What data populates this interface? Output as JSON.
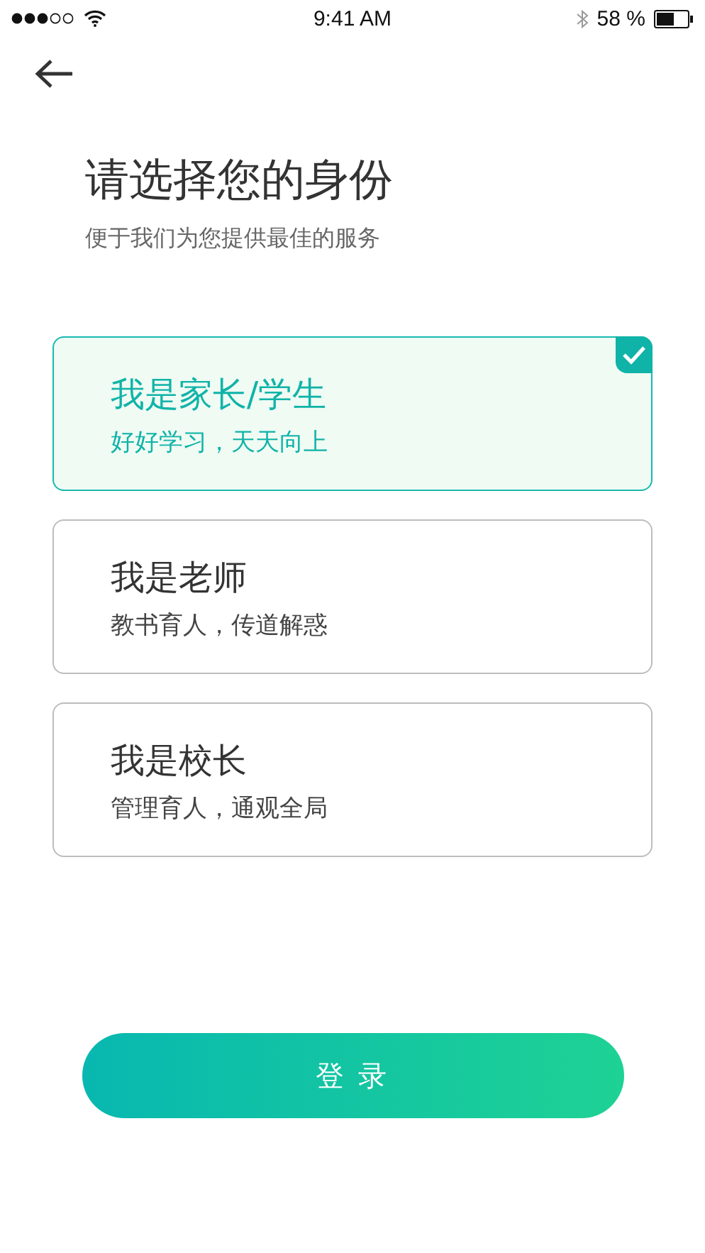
{
  "status_bar": {
    "time": "9:41 AM",
    "battery": "58 %"
  },
  "title": "请选择您的身份",
  "subtitle": "便于我们为您提供最佳的服务",
  "roles": [
    {
      "name": "我是家长/学生",
      "motto": "好好学习，天天向上",
      "selected": true
    },
    {
      "name": "我是老师",
      "motto": "教书育人，传道解惑",
      "selected": false
    },
    {
      "name": "我是校长",
      "motto": "管理育人，通观全局",
      "selected": false
    }
  ],
  "login_button": "登 录"
}
